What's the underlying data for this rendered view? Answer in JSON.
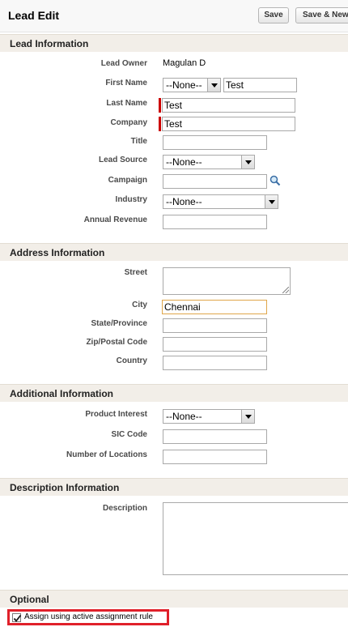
{
  "header": {
    "title": "Lead Edit",
    "save_label": "Save",
    "save_new_label": "Save & New"
  },
  "sections": {
    "lead_info": "Lead Information",
    "address_info": "Address Information",
    "additional_info": "Additional Information",
    "description_info": "Description Information",
    "optional": "Optional"
  },
  "lead": {
    "owner_label": "Lead Owner",
    "owner_value": "Magulan D",
    "first_name_label": "First Name",
    "salutation": "--None--",
    "first_name": "Test",
    "last_name_label": "Last Name",
    "last_name": "Test",
    "company_label": "Company",
    "company": "Test",
    "title_label": "Title",
    "title": "",
    "lead_source_label": "Lead Source",
    "lead_source": "--None--",
    "campaign_label": "Campaign",
    "campaign": "",
    "industry_label": "Industry",
    "industry": "--None--",
    "annual_revenue_label": "Annual Revenue",
    "annual_revenue": ""
  },
  "address": {
    "street_label": "Street",
    "street": "",
    "city_label": "City",
    "city": "Chennai",
    "state_label": "State/Province",
    "state": "",
    "zip_label": "Zip/Postal Code",
    "zip": "",
    "country_label": "Country",
    "country": ""
  },
  "additional": {
    "product_interest_label": "Product Interest",
    "product_interest": "--None--",
    "sic_label": "SIC Code",
    "sic": "",
    "locations_label": "Number of Locations",
    "locations": ""
  },
  "description": {
    "label": "Description",
    "value": ""
  },
  "optional": {
    "assign_label": "Assign using active assignment rule",
    "assign_checked": true
  },
  "icons": {
    "lookup": "magnifier-lookup-icon",
    "check": "checkmark-icon",
    "dropdown": "chevron-down-icon"
  }
}
